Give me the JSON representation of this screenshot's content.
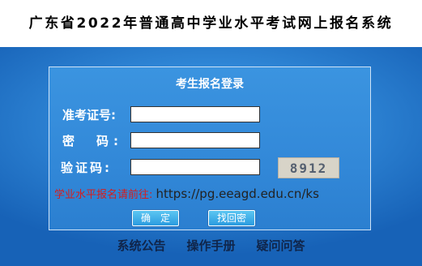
{
  "header": {
    "title": "广东省2022年普通高中学业水平考试网上报名系统"
  },
  "login": {
    "title": "考生报名登录",
    "id_label": "准考证号:",
    "password_label": "密　码:",
    "captcha_label": "验证码:",
    "id_value": "",
    "password_value": "",
    "captcha_value": "",
    "captcha_image_text": "8912",
    "notice_prefix": "学业水平报名请前往:",
    "notice_url": "https://pg.eeagd.edu.cn/ks",
    "confirm_label": "确　定",
    "recover_label": "找回密"
  },
  "footer": {
    "links": [
      "系统公告",
      "操作手册",
      "疑问问答"
    ]
  },
  "colors": {
    "background": "#1b6fc9",
    "panel": "#3288d8",
    "notice_red": "#d61d1d"
  }
}
